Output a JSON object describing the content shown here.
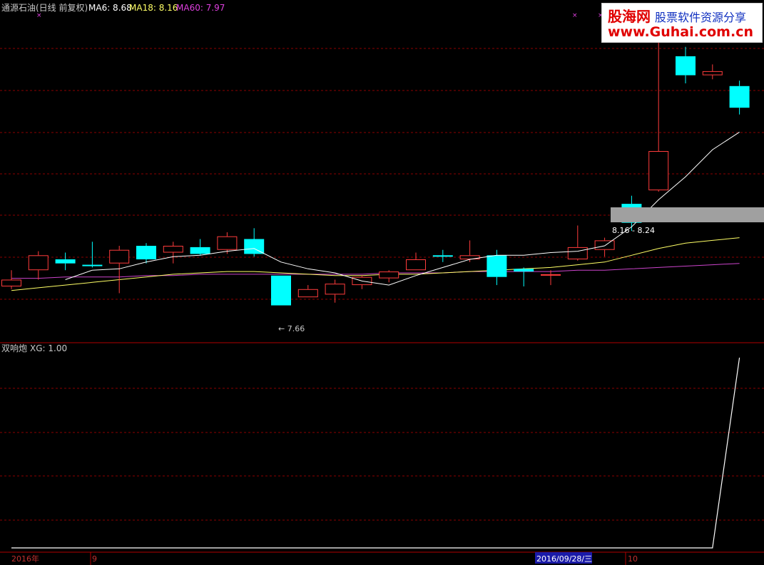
{
  "header": {
    "title": "通源石油(日线 前复权)",
    "ma6": "MA6: 8.68",
    "ma18": "MA18: 8.16",
    "ma60": "MA60: 7.97"
  },
  "sub_header": {
    "indicator": "双响炮",
    "value": "XG: 1.00"
  },
  "watermark": {
    "brand": "股海网",
    "slogan": "股票软件资源分享",
    "url": "www.Guhai.com.cn"
  },
  "annotations": {
    "low_label": "← 7.66",
    "range_label": "8.16 - 8.24"
  },
  "x_axis": {
    "year_label": "2016年",
    "month_sep": "9",
    "month_oct": "10",
    "cursor_date": "2016/09/28/三"
  },
  "colors": {
    "up": "#ff3c3c",
    "down": "#00ffff",
    "ma6": "#ffffff",
    "ma18": "#ffff66",
    "ma60": "#cc44cc",
    "grid": "#8b0000",
    "signal": "#ffffff"
  },
  "chart_data": {
    "type": "candlestick",
    "price_range": [
      7.6,
      9.6
    ],
    "candles": [
      {
        "o": 7.8,
        "c": 7.85,
        "h": 7.92,
        "l": 7.78
      },
      {
        "o": 7.92,
        "c": 8.03,
        "h": 8.06,
        "l": 7.85
      },
      {
        "o": 8.0,
        "c": 7.97,
        "h": 8.05,
        "l": 7.92
      },
      {
        "o": 7.96,
        "c": 7.95,
        "h": 8.13,
        "l": 7.94
      },
      {
        "o": 7.97,
        "c": 8.07,
        "h": 8.1,
        "l": 7.75
      },
      {
        "o": 8.1,
        "c": 8.0,
        "h": 8.12,
        "l": 7.97
      },
      {
        "o": 8.05,
        "c": 8.1,
        "h": 8.13,
        "l": 7.97
      },
      {
        "o": 8.09,
        "c": 8.04,
        "h": 8.15,
        "l": 8.03
      },
      {
        "o": 8.07,
        "c": 8.17,
        "h": 8.2,
        "l": 8.04
      },
      {
        "o": 8.15,
        "c": 8.04,
        "h": 8.23,
        "l": 8.02
      },
      {
        "o": 7.88,
        "c": 7.66,
        "h": 7.88,
        "l": 7.66
      },
      {
        "o": 7.72,
        "c": 7.78,
        "h": 7.81,
        "l": 7.72
      },
      {
        "o": 7.74,
        "c": 7.82,
        "h": 7.85,
        "l": 7.68
      },
      {
        "o": 7.81,
        "c": 7.87,
        "h": 7.88,
        "l": 7.78
      },
      {
        "o": 7.86,
        "c": 7.91,
        "h": 7.92,
        "l": 7.83
      },
      {
        "o": 7.92,
        "c": 8.0,
        "h": 8.05,
        "l": 7.92
      },
      {
        "o": 8.03,
        "c": 8.02,
        "h": 8.07,
        "l": 7.98
      },
      {
        "o": 8.0,
        "c": 8.03,
        "h": 8.14,
        "l": 7.98
      },
      {
        "o": 8.03,
        "c": 7.87,
        "h": 8.07,
        "l": 7.81
      },
      {
        "o": 7.93,
        "c": 7.91,
        "h": 7.94,
        "l": 7.8
      },
      {
        "o": 7.89,
        "c": 7.89,
        "h": 7.92,
        "l": 7.81
      },
      {
        "o": 8.0,
        "c": 8.09,
        "h": 8.25,
        "l": 7.99
      },
      {
        "o": 8.07,
        "c": 8.14,
        "h": 8.16,
        "l": 8.02
      },
      {
        "o": 8.41,
        "c": 8.27,
        "h": 8.47,
        "l": 8.21
      },
      {
        "o": 8.51,
        "c": 8.8,
        "h": 9.65,
        "l": 8.5
      },
      {
        "o": 9.5,
        "c": 9.36,
        "h": 9.57,
        "l": 9.3
      },
      {
        "o": 9.36,
        "c": 9.39,
        "h": 9.44,
        "l": 9.33
      },
      {
        "o": 9.28,
        "c": 9.12,
        "h": 9.32,
        "l": 9.07
      }
    ],
    "ma6": [
      null,
      null,
      7.85,
      7.92,
      7.93,
      7.98,
      8.02,
      8.03,
      8.06,
      8.08,
      7.98,
      7.93,
      7.9,
      7.84,
      7.81,
      7.88,
      7.94,
      8.0,
      8.03,
      8.03,
      8.05,
      8.06,
      8.1,
      8.24,
      8.44,
      8.61,
      8.81,
      8.94
    ],
    "ma18": [
      7.77,
      7.79,
      7.81,
      7.83,
      7.85,
      7.87,
      7.89,
      7.9,
      7.91,
      7.91,
      7.9,
      7.89,
      7.88,
      7.88,
      7.89,
      7.89,
      7.9,
      7.91,
      7.92,
      7.93,
      7.94,
      7.96,
      7.98,
      8.03,
      8.08,
      8.12,
      8.14,
      8.16
    ],
    "ma60": [
      7.86,
      7.86,
      7.87,
      7.87,
      7.87,
      7.88,
      7.88,
      7.89,
      7.89,
      7.89,
      7.89,
      7.89,
      7.89,
      7.89,
      7.9,
      7.9,
      7.9,
      7.91,
      7.91,
      7.91,
      7.91,
      7.92,
      7.92,
      7.93,
      7.94,
      7.95,
      7.96,
      7.97
    ],
    "signal": {
      "name": "XG",
      "range": [
        0,
        1
      ],
      "values": [
        0,
        0,
        0,
        0,
        0,
        0,
        0,
        0,
        0,
        0,
        0,
        0,
        0,
        0,
        0,
        0,
        0,
        0,
        0,
        0,
        0,
        0,
        0,
        0,
        0,
        0,
        0,
        1
      ]
    }
  }
}
